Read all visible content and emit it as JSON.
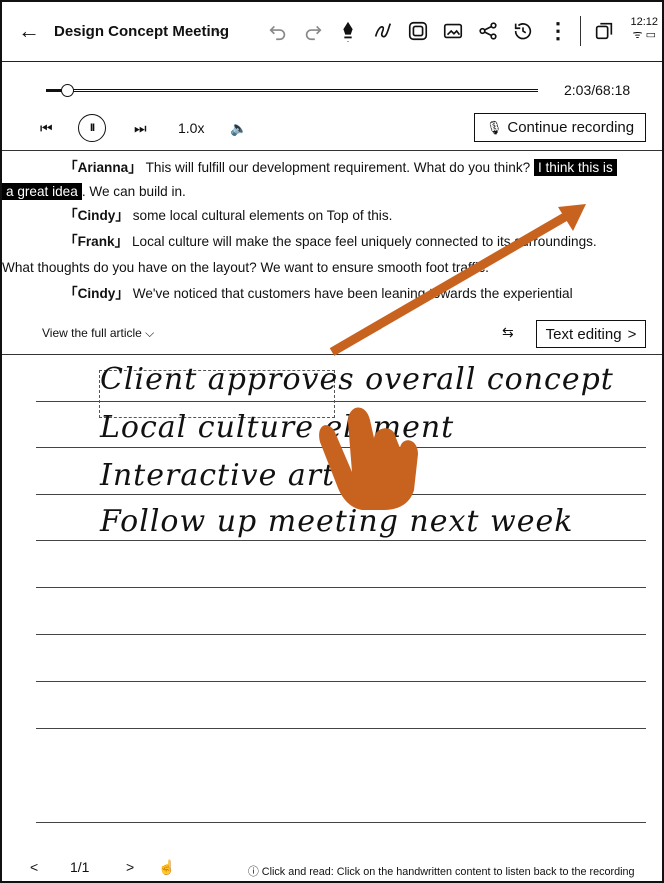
{
  "header": {
    "back_glyph": "←",
    "title": "Design Concept Meeting",
    "title_caret": "⌵",
    "icons": [
      "undo-icon",
      "redo-icon",
      "pen-icon",
      "lasso-icon",
      "template-icon",
      "image-icon",
      "share-icon",
      "history-icon",
      "more-icon",
      "window-icon"
    ],
    "more_glyph": "⋮",
    "clock_time": "12:12",
    "status_glyphs": "ᯤ ▭"
  },
  "player": {
    "progress_fraction": 0.03,
    "time": "2:03/68:18",
    "prev_glyph": "⏮",
    "pause_glyph": "II",
    "next_glyph": "⏭",
    "speed": "1.0x",
    "volume_glyph": "🔈",
    "continue_label": "Continue recording",
    "mic_glyph": "🎙"
  },
  "transcript": {
    "l1_speaker": "「Arianna」",
    "l1_text": " This will fulfill our development requirement. What do you think?",
    "l1_highlight": "I think this is",
    "l2_highlight": "a great idea",
    "l2_text": ". We can build in.",
    "l3_speaker": "「Cindy」",
    "l3_text": " some local cultural elements on Top of this.",
    "l4_speaker": "「Frank」",
    "l4_text": " Local culture will make the space feel uniquely connected to its surroundings.",
    "l5_text": "What thoughts do you have on the layout? We want to ensure smooth foot traffic.",
    "l6_speaker": "「Cindy」",
    "l6_text": " We've noticed that customers have been leaning towards the experiential",
    "view_full": "View the full article ⌵",
    "swap_glyph": "⇆",
    "text_editing": "Text editing",
    "text_editing_chevron": ">"
  },
  "notebook": {
    "lines": [
      "Client approves overall concept",
      "Local culture element",
      "Interactive art",
      "Follow up meeting next week"
    ]
  },
  "footer": {
    "prev_glyph": "<",
    "page": "1/1",
    "next_glyph": ">",
    "touch_glyph": "☝",
    "hint": "ⓘ Click and read: Click on the handwritten content to listen back to the recording"
  },
  "colors": {
    "arrow": "#c8621f",
    "hand": "#c8621f",
    "text": "#111111"
  }
}
